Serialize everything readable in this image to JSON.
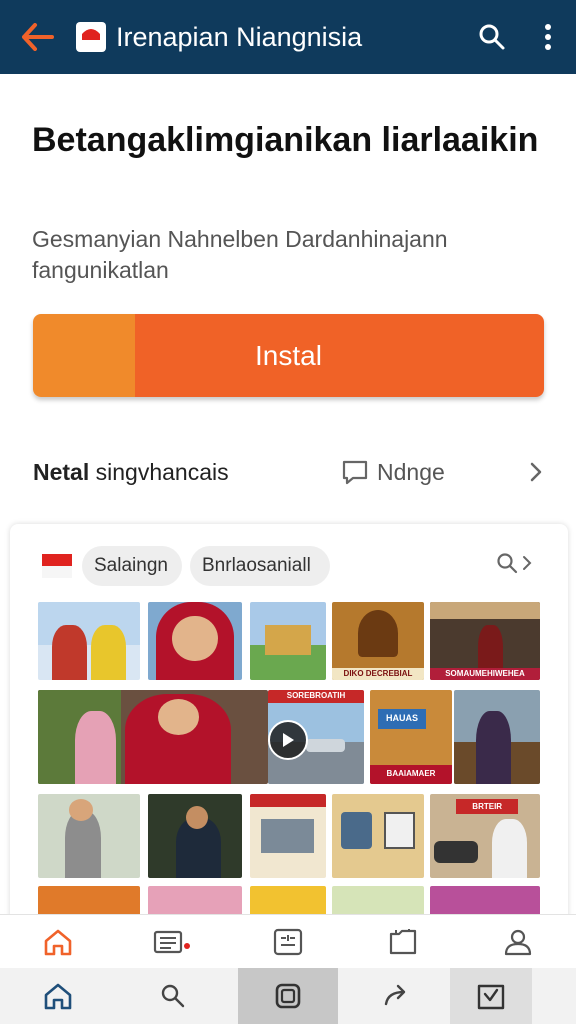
{
  "header": {
    "title": "Irenapian Niangnisia",
    "colors": {
      "bar": "#0f3a5c",
      "back_arrow": "#f0622a"
    },
    "icons": [
      "back-arrow-icon",
      "app-logo-icon",
      "search-icon",
      "more-vert-icon"
    ]
  },
  "hero": {
    "headline": "Betangaklimgianikan liarlaaikin",
    "subtitle": "Gesmanyian Nahnelben Dardanhinajann fangunikatlan"
  },
  "install_button": {
    "label": "Instal",
    "color": "#f06227"
  },
  "info_row": {
    "left_bold": "Netal",
    "left_rest": "singvhancais",
    "mid_label": "Ndnge",
    "icons": [
      "message-icon",
      "chevron-right-icon"
    ]
  },
  "gallery": {
    "chips": [
      "Salaingn",
      "Bnrlaosaniall"
    ],
    "icons": [
      "flag-icon",
      "search-icon",
      "chevron-right-icon"
    ],
    "tile_texts": [
      "DIKO DECREBIAL",
      "SOMAUMEHIWEHEA",
      "SOREBROATIH",
      "HAUAS",
      "BAAIAMAER",
      "BRTEIR"
    ]
  },
  "tab_bar": {
    "icons": [
      "home-icon",
      "news-icon",
      "apps-icon",
      "folder-icon",
      "profile-icon"
    ],
    "active_color": "#f0622a"
  },
  "system_nav": {
    "icons": [
      "home-outline-icon",
      "search-icon",
      "square-icon",
      "share-arrow-icon",
      "shield-check-icon"
    ]
  }
}
